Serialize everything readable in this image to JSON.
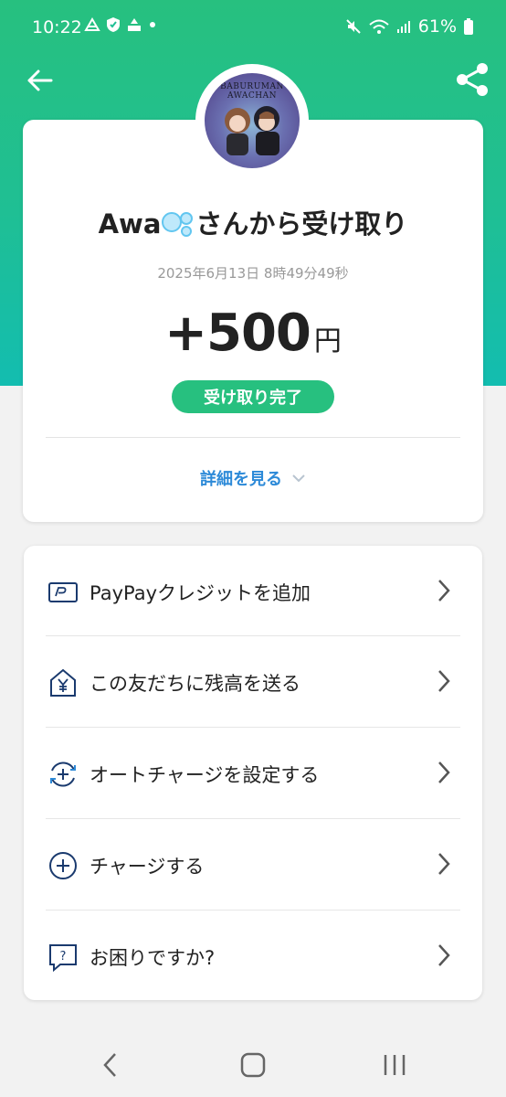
{
  "status_bar": {
    "time": "10:22",
    "battery": "61%"
  },
  "header": {
    "back_icon": "arrow-left-icon",
    "share_icon": "share-icon"
  },
  "receipt": {
    "avatar_text": "BABURUMAN AWACHAN",
    "title_prefix": "Awa",
    "title_suffix": "さんから受け取り",
    "date": "2025年6月13日 8時49分49秒",
    "amount": "+500",
    "currency": "円",
    "status": "受け取り完了",
    "details_link": "詳細を見る",
    "brand_color": "#27c07f",
    "link_color": "#2d8ad8"
  },
  "menu": {
    "items": [
      {
        "label": "PayPayクレジットを追加",
        "icon": "credit-card-icon"
      },
      {
        "label": "この友だちに残高を送る",
        "icon": "yen-house-icon"
      },
      {
        "label": "オートチャージを設定する",
        "icon": "auto-charge-icon"
      },
      {
        "label": "チャージする",
        "icon": "plus-circle-icon"
      },
      {
        "label": "お困りですか?",
        "icon": "help-chat-icon"
      }
    ]
  },
  "nav_bar": {
    "back": "back-icon",
    "home": "home-icon",
    "recents": "recents-icon"
  }
}
